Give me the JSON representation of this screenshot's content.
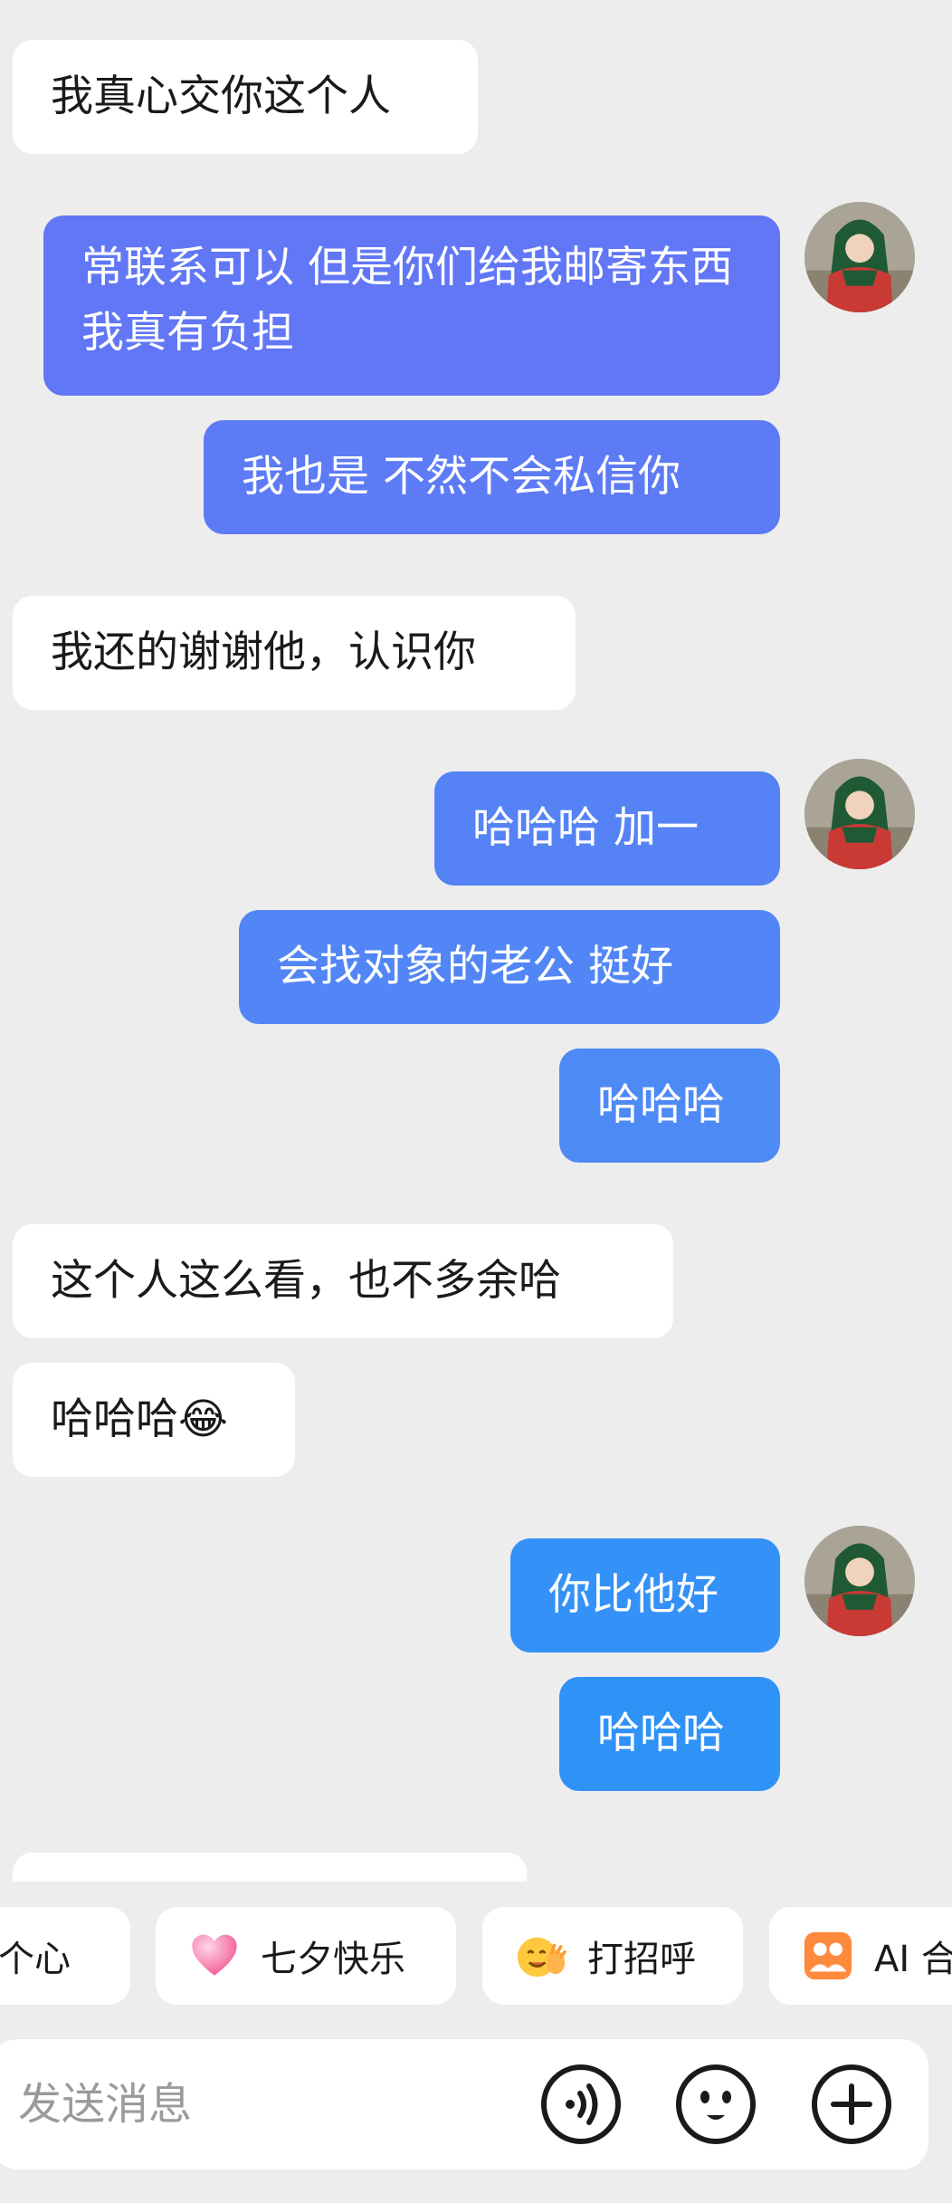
{
  "messages": [
    {
      "side": "in",
      "text": "我真心交你这个人"
    },
    {
      "side": "out",
      "text": "常联系可以  但是你们给我邮寄东西 我真有负担",
      "color": "#6177f6"
    },
    {
      "side": "out",
      "text": "我也是 不然不会私信你",
      "color": "#5d7bf5"
    },
    {
      "side": "in",
      "text": "我还的谢谢他，认识你"
    },
    {
      "side": "out",
      "text": "哈哈哈  加一",
      "color": "#5583f6"
    },
    {
      "side": "out",
      "text": "会找对象的老公  挺好",
      "color": "#5286f6"
    },
    {
      "side": "out",
      "text": "哈哈哈",
      "color": "#4d8af5"
    },
    {
      "side": "in",
      "text": "这个人这么看，也不多余哈"
    },
    {
      "side": "in",
      "text": "哈哈哈😂"
    },
    {
      "side": "out",
      "text": "你比他好",
      "color": "#3391f7"
    },
    {
      "side": "out",
      "text": "哈哈哈",
      "color": "#2f92f7"
    }
  ],
  "quick_replies": [
    {
      "label": "个心",
      "icon": null
    },
    {
      "label": "七夕快乐",
      "icon": "pink-heart-icon"
    },
    {
      "label": "打招呼",
      "icon": "waving-face-icon"
    },
    {
      "label": "AI 合",
      "icon": "ai-group-photo-icon"
    }
  ],
  "composer": {
    "placeholder": "发送消息",
    "voice_icon": "voice-icon",
    "emoji_icon": "emoji-icon",
    "plus_icon": "plus-icon"
  }
}
